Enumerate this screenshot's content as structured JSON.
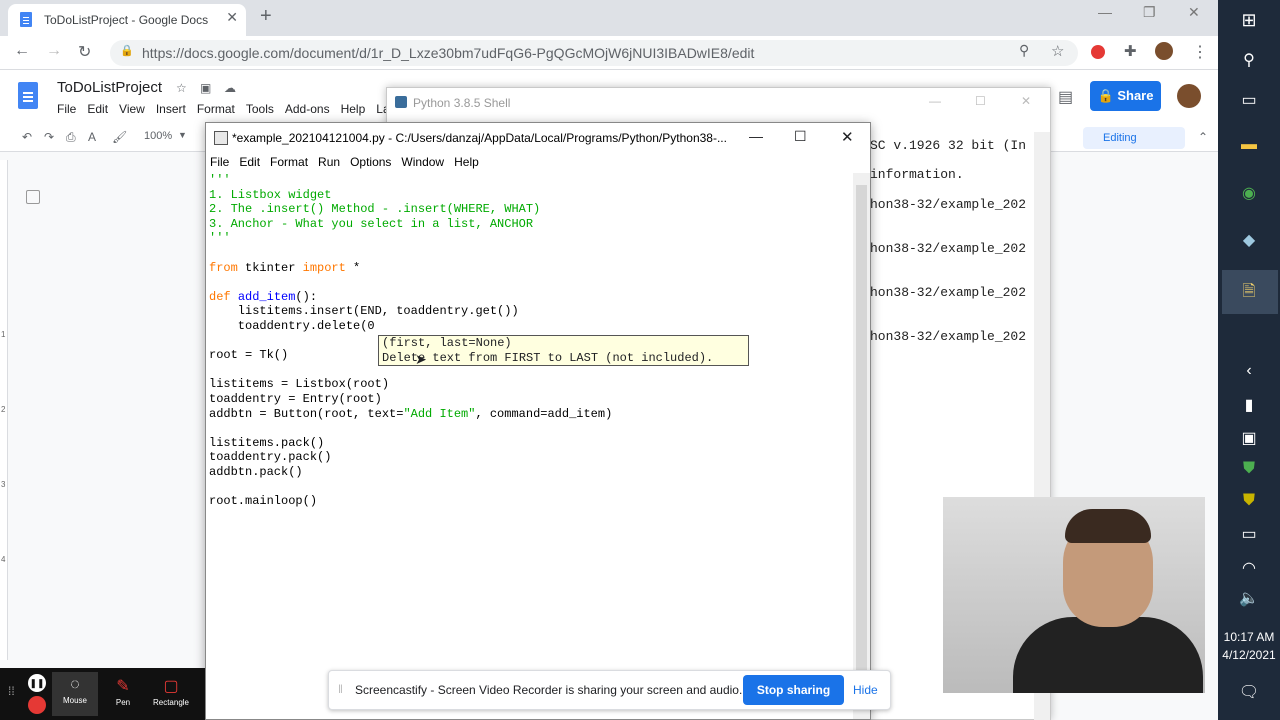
{
  "browser": {
    "tab_title": "ToDoListProject - Google Docs",
    "url": "https://docs.google.com/document/d/1r_D_Lxze30bm7udFqG6-PgQGcMOjW6jNUI3IBADwIE8/edit"
  },
  "docs": {
    "title": "ToDoListProject",
    "menu": [
      "File",
      "Edit",
      "View",
      "Insert",
      "Format",
      "Tools",
      "Add-ons",
      "Help",
      "La"
    ],
    "zoom": "100%",
    "share_label": "Share",
    "mode_label": "Editing",
    "ruler_marks": [
      "1",
      "2",
      "3",
      "4"
    ]
  },
  "shell": {
    "title": "Python 3.8.5 Shell",
    "lines": [
      "SC v.1926 32 bit (In",
      "information.",
      "hon38-32/example_202",
      "hon38-32/example_202",
      "hon38-32/example_202",
      "hon38-32/example_202"
    ]
  },
  "editor": {
    "title": "*example_202104121004.py - C:/Users/danzaj/AppData/Local/Programs/Python/Python38-...",
    "menu": [
      "File",
      "Edit",
      "Format",
      "Run",
      "Options",
      "Window",
      "Help"
    ],
    "code": {
      "l0": "'''",
      "l1": "1. Listbox widget",
      "l2": "2. The .insert() Method - .insert(WHERE, WHAT)",
      "l3": "3. Anchor - What you select in a list, ANCHOR",
      "l4": "'''",
      "kw_from": "from",
      "mod": " tkinter ",
      "kw_import": "import",
      "star": " *",
      "kw_def": "def",
      "fn": "add_item",
      "fn_tail": "():",
      "l_insert": "    listitems.insert(END, toaddentry.get())",
      "l_delete": "    toaddentry.delete(0",
      "l_root": "root = Tk()",
      "l_lb": "listitems = Listbox(root)",
      "l_entry": "toaddentry = Entry(root)",
      "l_btn_a": "addbtn = Button(root, text=",
      "l_btn_str": "\"Add Item\"",
      "l_btn_b": ", command=add_item)",
      "l_p1": "listitems.pack()",
      "l_p2": "toaddentry.pack()",
      "l_p3": "addbtn.pack()",
      "l_main": "root.mainloop()"
    },
    "tooltip": {
      "line1": "(first, last=None)",
      "line2": "Delete text from FIRST to LAST (not included)."
    }
  },
  "screencastify": {
    "message": "Screencastify - Screen Video Recorder is sharing your screen and audio.",
    "stop_label": "Stop sharing",
    "hide_label": "Hide",
    "tools": [
      "Mouse",
      "Pen",
      "Rectangle"
    ]
  },
  "taskbar": {
    "time": "10:17 AM",
    "date": "4/12/2021"
  }
}
